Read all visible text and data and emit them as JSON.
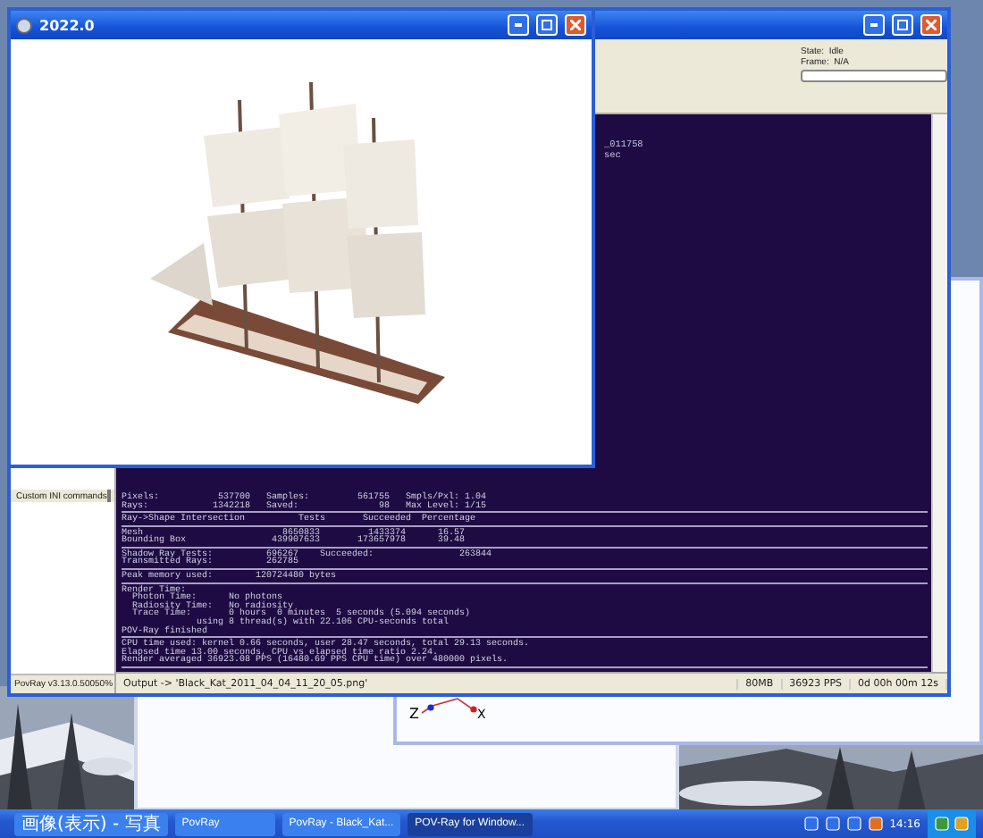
{
  "render_window": {
    "title": "2022.0"
  },
  "main_window": {
    "status": {
      "state": "State:  Idle",
      "frame": "Frame:  N/A",
      "progress": {
        "level": 0
      }
    },
    "left_panel": {
      "custom_ini": {
        "label": "Custom INI commands",
        "checked": false
      },
      "version": "PovRay v3.13.0.500",
      "zoom": "50%"
    },
    "messages": {
      "partial_lines": [
        "_011758",
        "sec"
      ],
      "lines": [
        {
          "kind": "text",
          "text": "Pixels:           537700   Samples:         561755   Smpls/Pxl: 1.04"
        },
        {
          "kind": "text",
          "text": "Rays:            1342218   Saved:               98   Max Level: 1/15"
        },
        {
          "kind": "rule"
        },
        {
          "kind": "text",
          "text": "Ray->Shape Intersection          Tests       Succeeded  Percentage"
        },
        {
          "kind": "rule"
        },
        {
          "kind": "text",
          "text": "Mesh                          8650833         1433374      16.57"
        },
        {
          "kind": "text",
          "text": "Bounding Box                439907633       173657978      39.48"
        },
        {
          "kind": "rule"
        },
        {
          "kind": "text",
          "text": "Shadow Ray Tests:          696267    Succeeded:                263844"
        },
        {
          "kind": "text",
          "text": "Transmitted Rays:          262785"
        },
        {
          "kind": "rule"
        },
        {
          "kind": "text",
          "text": "Peak memory used:        120724480 bytes"
        },
        {
          "kind": "rule"
        },
        {
          "kind": "text",
          "text": "Render Time:"
        },
        {
          "kind": "text",
          "text": "  Photon Time:      No photons"
        },
        {
          "kind": "text",
          "text": "  Radiosity Time:   No radiosity"
        },
        {
          "kind": "text",
          "text": "  Trace Time:       0 hours  0 minutes  5 seconds (5.094 seconds)"
        },
        {
          "kind": "text",
          "text": "              using 8 thread(s) with 22.106 CPU-seconds total"
        },
        {
          "kind": "text",
          "text": "POV-Ray finished"
        },
        {
          "kind": "rule"
        },
        {
          "kind": "text",
          "text": "CPU time used: kernel 0.66 seconds, user 28.47 seconds, total 29.13 seconds."
        },
        {
          "kind": "text",
          "text": "Elapsed time 13.00 seconds, CPU vs elapsed time ratio 2.24."
        },
        {
          "kind": "text",
          "text": "Render averaged 36923.08 PPS (16480.69 PPS CPU time) over 480000 pixels."
        },
        {
          "kind": "rule"
        }
      ]
    },
    "status_bar": [
      "Output -> 'Black_Kat_2011_04_04_11_20_05.png'",
      "80MB",
      "36923 PPS",
      "0d 00h 00m 12s"
    ]
  },
  "axes_window": {
    "axes": [
      {
        "label": "Z"
      },
      {
        "label": "X"
      }
    ]
  },
  "taskbar": {
    "items": [
      {
        "label": "画像(表示) - 写真",
        "selected": false
      },
      {
        "label": "PovRay",
        "selected": false
      },
      {
        "label": "PovRay - Black_Kat...",
        "selected": false
      },
      {
        "label": "POV-Ray for Window...",
        "selected": true
      }
    ],
    "clock": "14:16"
  }
}
